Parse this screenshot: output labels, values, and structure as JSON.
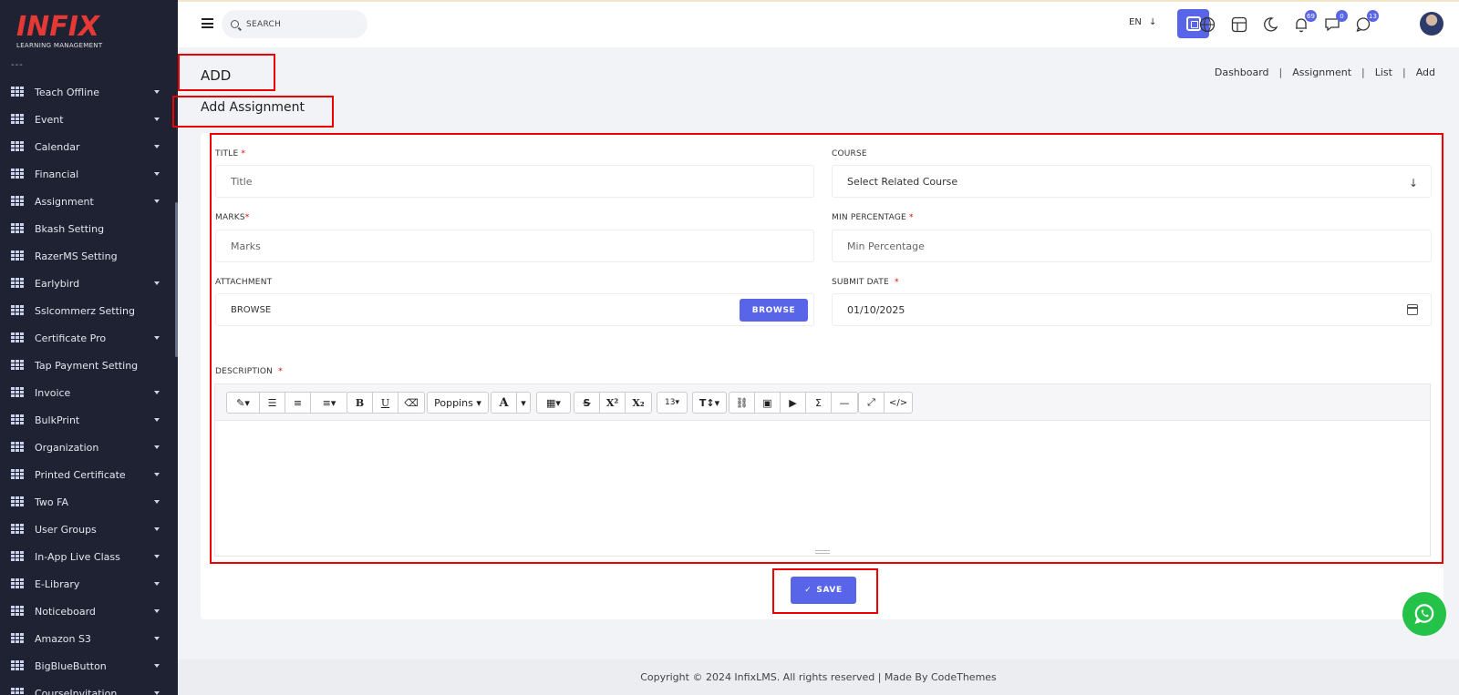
{
  "brand": {
    "logo_text": "INFIX",
    "logo_sub": "LEARNING MANAGEMENT"
  },
  "sidebar": {
    "dash": "---",
    "items": [
      {
        "label": "Teach Offline",
        "caret": true
      },
      {
        "label": "Event",
        "caret": true
      },
      {
        "label": "Calendar",
        "caret": true
      },
      {
        "label": "Financial",
        "caret": true
      },
      {
        "label": "Assignment",
        "caret": true
      },
      {
        "label": "Bkash Setting",
        "caret": false
      },
      {
        "label": "RazerMS Setting",
        "caret": false
      },
      {
        "label": "Earlybird",
        "caret": true
      },
      {
        "label": "Sslcommerz Setting",
        "caret": false
      },
      {
        "label": "Certificate Pro",
        "caret": true
      },
      {
        "label": "Tap Payment Setting",
        "caret": false
      },
      {
        "label": "Invoice",
        "caret": true
      },
      {
        "label": "BulkPrint",
        "caret": true
      },
      {
        "label": "Organization",
        "caret": true
      },
      {
        "label": "Printed Certificate",
        "caret": true
      },
      {
        "label": "Two FA",
        "caret": true
      },
      {
        "label": "User Groups",
        "caret": true
      },
      {
        "label": "In-App Live Class",
        "caret": true
      },
      {
        "label": "E-Library",
        "caret": true
      },
      {
        "label": "Noticeboard",
        "caret": true
      },
      {
        "label": "Amazon S3",
        "caret": true
      },
      {
        "label": "BigBlueButton",
        "caret": true
      },
      {
        "label": "CourseInvitation",
        "caret": true
      }
    ]
  },
  "header": {
    "search_placeholder": "SEARCH",
    "language": "EN",
    "badges": {
      "notifications": "69",
      "messages": "0",
      "chats": "13"
    },
    "accent": "#5865e8"
  },
  "page": {
    "section": "ADD",
    "title": "Add Assignment",
    "breadcrumb": [
      "Dashboard",
      "Assignment",
      "List",
      "Add"
    ]
  },
  "form": {
    "title_label": "TITLE",
    "title_placeholder": "Title",
    "course_label": "COURSE",
    "course_placeholder": "Select Related Course",
    "marks_label": "MARKS",
    "marks_placeholder": "Marks",
    "min_pct_label": "MIN PERCENTAGE",
    "min_pct_placeholder": "Min Percentage",
    "attachment_label": "ATTACHMENT",
    "attachment_value": "BROWSE",
    "browse_button": "BROWSE",
    "submit_date_label": "SUBMIT DATE",
    "submit_date_value": "01/10/2025",
    "description_label": "DESCRIPTION",
    "required_mark": "*"
  },
  "editor": {
    "font_name": "Poppins",
    "font_size": "13"
  },
  "save_button": "SAVE",
  "footer": "Copyright © 2024 InfixLMS. All rights reserved | Made By CodeThemes"
}
